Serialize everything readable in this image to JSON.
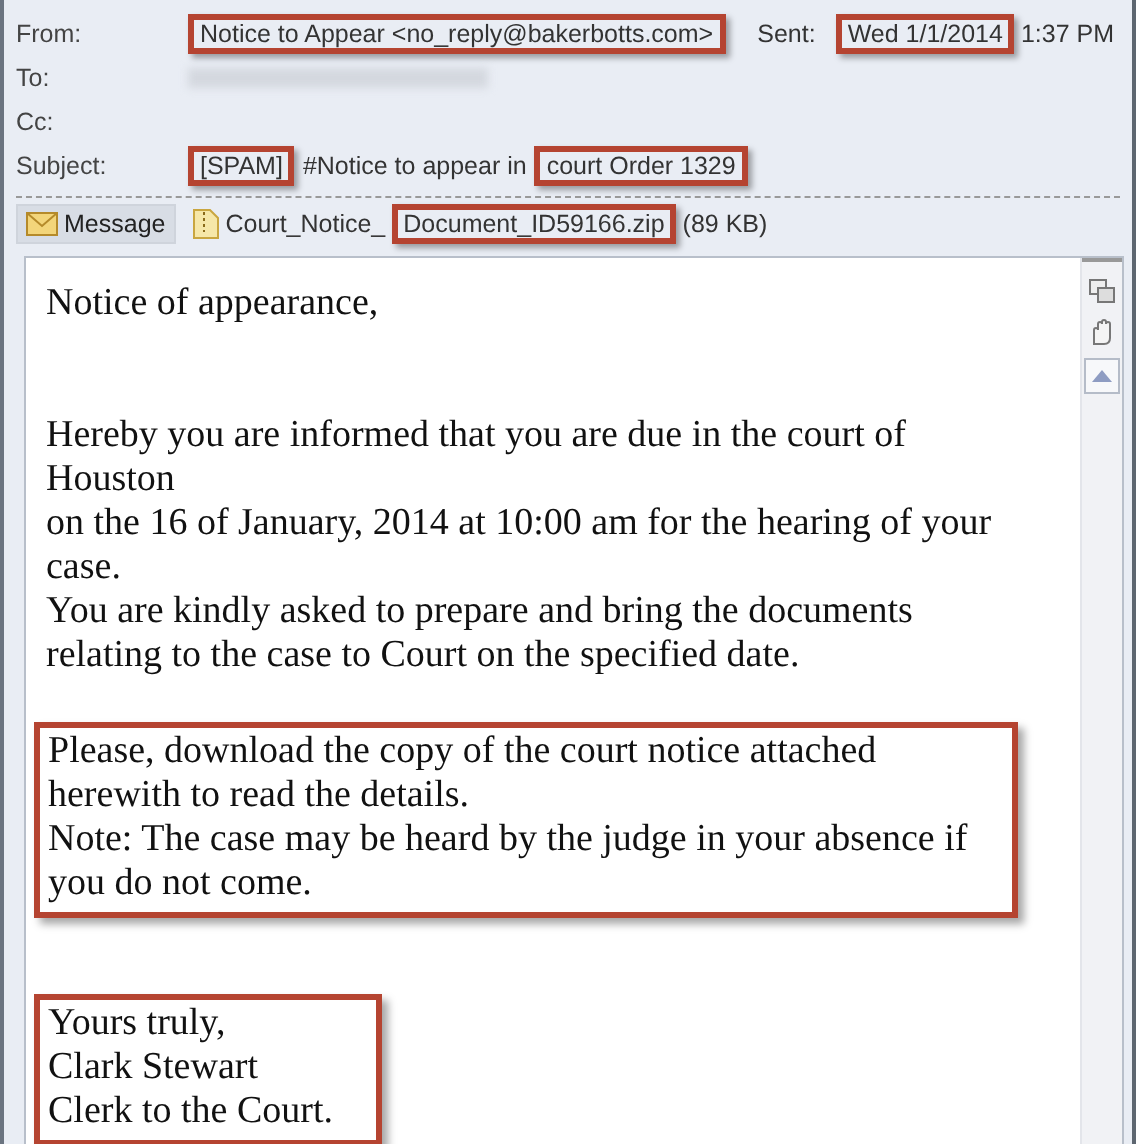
{
  "header": [
    {
      "label": "From:",
      "segments": [
        {
          "text": "Notice to Appear <no_reply@bakerbotts.com>",
          "highlighted": true
        }
      ],
      "sent": {
        "label": "Sent:",
        "segments": [
          {
            "text": "Wed 1/1/2014",
            "highlighted": true
          },
          {
            "text": "1:37 PM",
            "highlighted": false
          }
        ]
      }
    },
    {
      "label": "To:",
      "redacted": true
    },
    {
      "label": "Cc:"
    },
    {
      "label": "Subject:",
      "segments": [
        {
          "text": "[SPAM]",
          "highlighted": true
        },
        {
          "text": "#Notice to appear in",
          "highlighted": false
        },
        {
          "text": "court Order 1329",
          "highlighted": true
        }
      ]
    }
  ],
  "tabs": [
    {
      "label": "Message",
      "selected": true,
      "kind": "message"
    },
    {
      "kind": "attachment",
      "selected": false,
      "segments": [
        {
          "text": "Court_Notice_",
          "highlighted": false
        },
        {
          "text": "Document_ID59166.zip",
          "highlighted": true
        },
        {
          "text": "(89 KB)",
          "highlighted": false
        }
      ]
    }
  ],
  "body": [
    {
      "lines": [
        "Notice of appearance,"
      ],
      "highlighted": false
    },
    {
      "lines": [
        "Hereby you are informed that you are due in the court of",
        "Houston",
        "on the 16 of January, 2014 at 10:00 am for the hearing of your",
        "case.",
        "You are kindly asked to prepare and bring the documents",
        "relating to the case to Court on the specified date."
      ],
      "highlighted": false
    },
    {
      "lines": [
        "Please, download the copy of the court notice attached",
        "herewith to read the details.",
        "Note: The case may be heard by the judge in your absence if",
        "you do not come."
      ],
      "highlighted": true
    },
    {
      "lines": [
        "Yours truly,",
        "Clark Stewart",
        "Clerk to the Court."
      ],
      "highlighted": true
    }
  ]
}
